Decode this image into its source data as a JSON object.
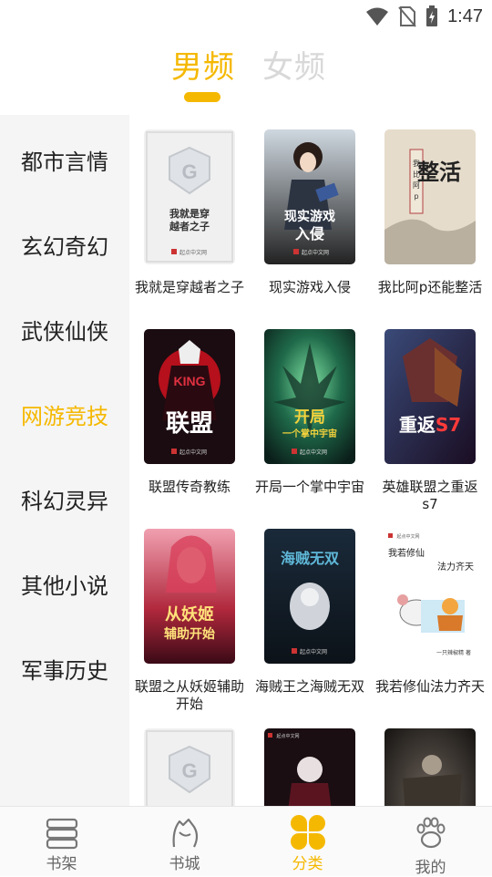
{
  "status_bar": {
    "time": "1:47"
  },
  "gender_tabs": [
    {
      "label": "男频",
      "active": true
    },
    {
      "label": "女频",
      "active": false
    }
  ],
  "categories": [
    {
      "label": "都市言情",
      "active": false
    },
    {
      "label": "玄幻奇幻",
      "active": false
    },
    {
      "label": "武侠仙侠",
      "active": false
    },
    {
      "label": "网游竞技",
      "active": true
    },
    {
      "label": "科幻灵异",
      "active": false
    },
    {
      "label": "其他小说",
      "active": false
    },
    {
      "label": "军事历史",
      "active": false
    }
  ],
  "books": [
    {
      "title": "我就是穿越者之子",
      "cover_text": "我就是穿越者之子",
      "publisher": "起点中文网"
    },
    {
      "title": "现实游戏入侵",
      "cover_text": "现实游戏入侵",
      "publisher": "起点中文网"
    },
    {
      "title": "我比阿p还能整活",
      "cover_text": "整活",
      "publisher": ""
    },
    {
      "title": "联盟传奇教练",
      "cover_text": "联盟",
      "publisher": "起点中文网"
    },
    {
      "title": "开局一个掌中宇宙",
      "cover_text": "开局一个掌中宇宙",
      "publisher": "起点中文网"
    },
    {
      "title": "英雄联盟之重返s7",
      "cover_text": "重返S7",
      "publisher": ""
    },
    {
      "title": "联盟之从妖姬辅助开始",
      "cover_text": "从妖姬辅助开始",
      "publisher": ""
    },
    {
      "title": "海贼王之海贼无双",
      "cover_text": "海贼无双",
      "publisher": "起点中文网"
    },
    {
      "title": "我若修仙法力齐天",
      "cover_text": "我若修仙 法力齐天",
      "publisher": "起点中文网",
      "author": "一只辣椒精 著"
    },
    {
      "title": "",
      "cover_text": "",
      "publisher": ""
    },
    {
      "title": "",
      "cover_text": "",
      "publisher": "起点中文网"
    },
    {
      "title": "",
      "cover_text": "",
      "publisher": ""
    }
  ],
  "bottom_nav": [
    {
      "label": "书架",
      "icon": "bookshelf-icon",
      "active": false
    },
    {
      "label": "书城",
      "icon": "bookstore-icon",
      "active": false
    },
    {
      "label": "分类",
      "icon": "category-clover-icon",
      "active": true
    },
    {
      "label": "我的",
      "icon": "paw-profile-icon",
      "active": false
    }
  ],
  "colors": {
    "accent": "#f5b800",
    "sidebar_bg": "#f5f5f5",
    "inactive_tab": "#d8d8d8"
  }
}
